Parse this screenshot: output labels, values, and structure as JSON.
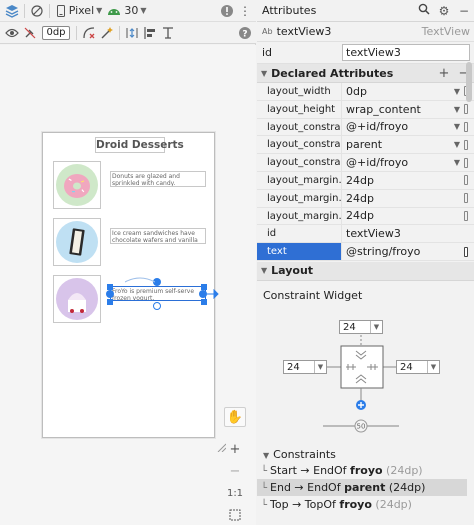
{
  "toolbar": {
    "device": "Pixel",
    "api": "30",
    "default_margin": "0dp"
  },
  "canvas": {
    "app_title": "Droid Desserts",
    "items": [
      {
        "description": "Donuts are glazed and sprinkled with candy."
      },
      {
        "description": "Ice cream sandwiches have chocolate wafers and vanilla filling."
      },
      {
        "description": "FroYo is premium self-serve frozen yogurt."
      }
    ],
    "zoom_ratio": "1:1"
  },
  "attributes_panel": {
    "title": "Attributes",
    "component": {
      "badge": "Ab",
      "name": "textView3",
      "type": "TextView"
    },
    "id_label": "id",
    "id_value": "textView3",
    "declared_title": "Declared Attributes",
    "declared": [
      {
        "key": "layout_width",
        "value": "0dp"
      },
      {
        "key": "layout_height",
        "value": "wrap_content"
      },
      {
        "key": "layout_constra...",
        "value": "@+id/froyo"
      },
      {
        "key": "layout_constra...",
        "value": "parent"
      },
      {
        "key": "layout_constra...",
        "value": "@+id/froyo"
      },
      {
        "key": "layout_margin...",
        "value": "24dp"
      },
      {
        "key": "layout_margin...",
        "value": "24dp"
      },
      {
        "key": "layout_margin...",
        "value": "24dp"
      },
      {
        "key": "id",
        "value": "textView3"
      },
      {
        "key": "text",
        "value": "@string/froyo"
      }
    ],
    "layout_title": "Layout",
    "constraint_widget_label": "Constraint Widget",
    "margin_top": "24",
    "margin_start": "24",
    "margin_end": "24",
    "bias": "50",
    "constraints_title": "Constraints",
    "constraints": [
      {
        "from": "Start → EndOf ",
        "target": "froyo",
        "margin": "(24dp)"
      },
      {
        "from": "End → EndOf ",
        "target": "parent",
        "margin": "(24dp)"
      },
      {
        "from": "Top → TopOf ",
        "target": "froyo",
        "margin": "(24dp)"
      }
    ]
  },
  "colors": {
    "selection_blue": "#2b7de9",
    "highlight_row": "#2f6fd4",
    "api_green": "#3f9a4a"
  }
}
